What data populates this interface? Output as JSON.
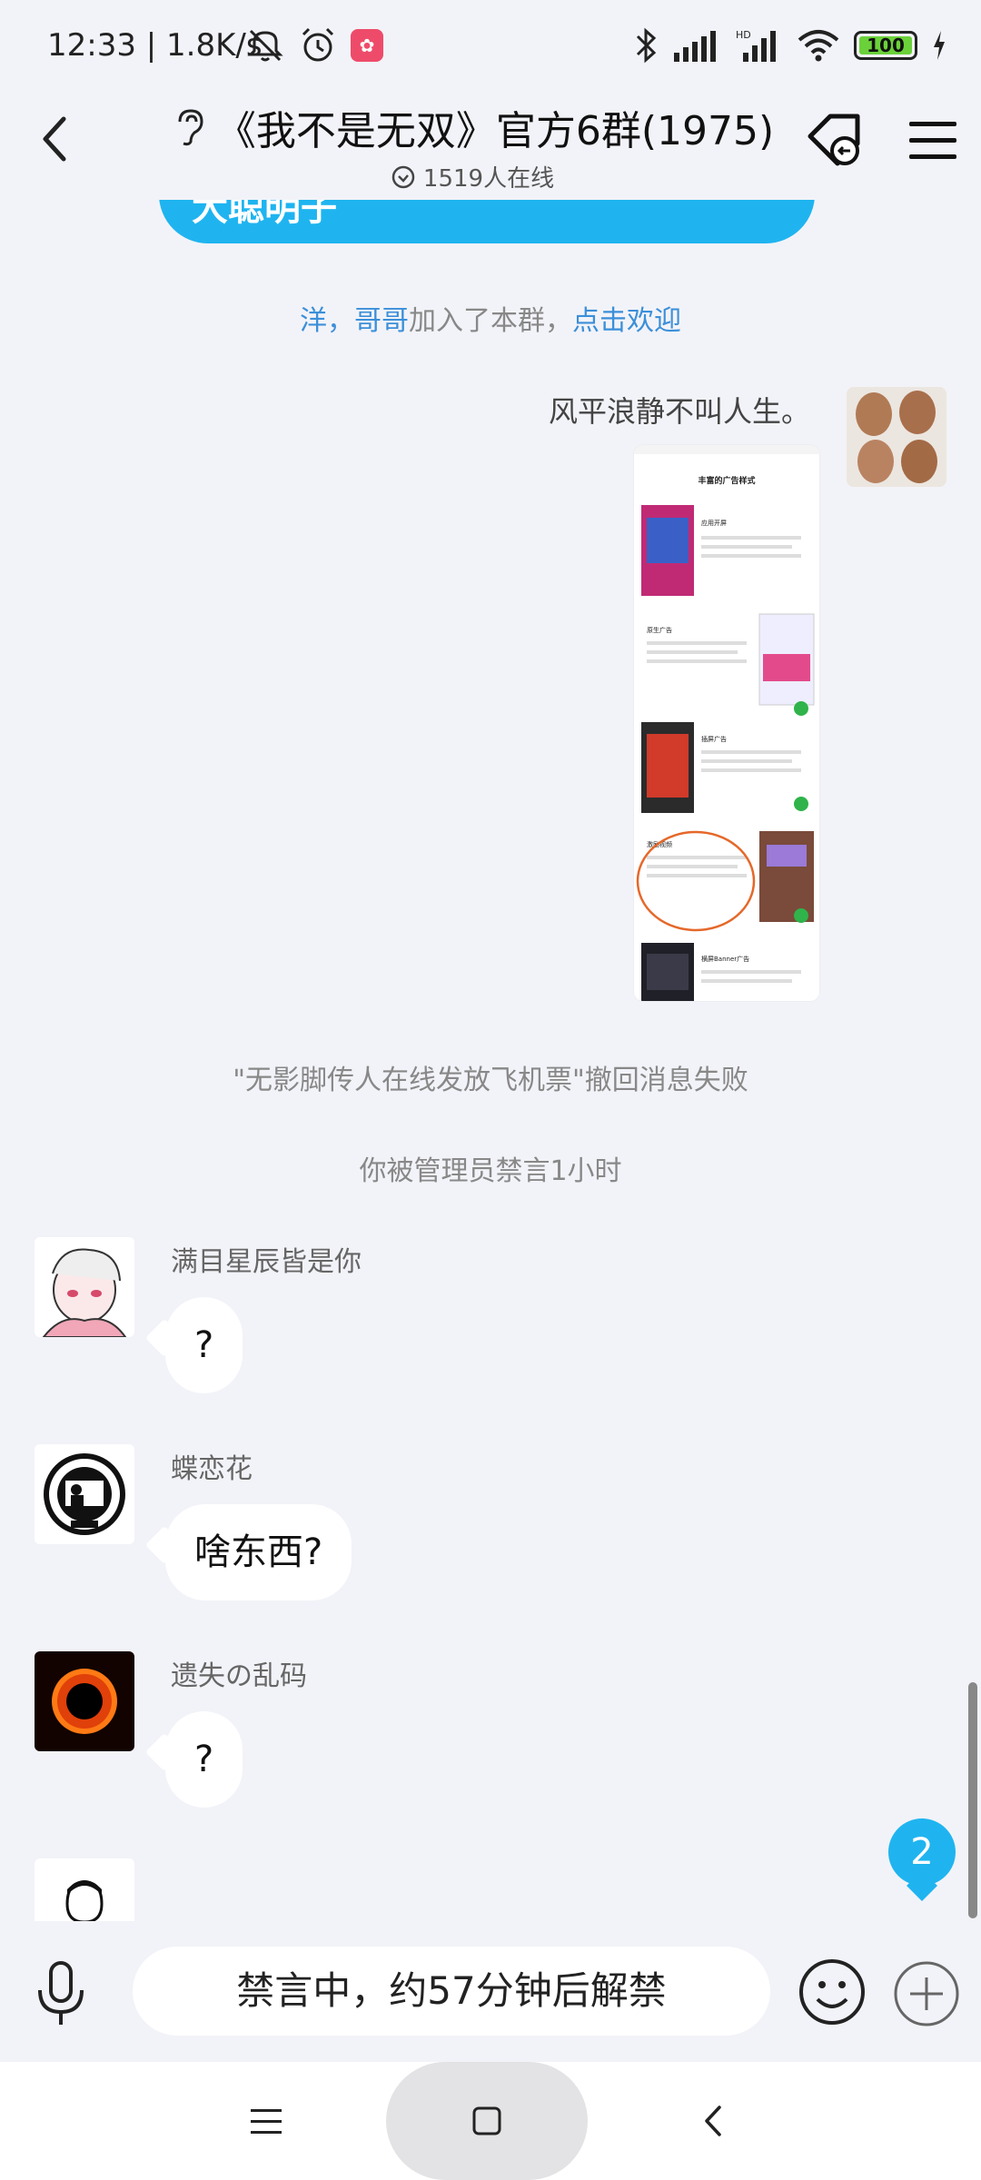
{
  "status_bar": {
    "time_speed": "12:33 | 1.8K/s",
    "battery": "100",
    "app_badge": "✿"
  },
  "header": {
    "title": "《我不是无双》官方6群(1975)",
    "online": "1519人在线"
  },
  "messages": {
    "prev_card_text": "大聪明子",
    "join_notice": {
      "name": "洋，哥哥",
      "text": "加入了本群，",
      "link": "点击欢迎"
    },
    "my_text": "风平浪静不叫人生。",
    "recall_failed": "\"无影脚传人在线发放飞机票\"撤回消息失败",
    "muted_notice": "你被管理员禁言1小时",
    "chat": [
      {
        "sender": "满目星辰皆是你",
        "text": "?"
      },
      {
        "sender": "蝶恋花",
        "text": "啥东西?"
      },
      {
        "sender": "遗失の乱码",
        "text": "?"
      }
    ]
  },
  "image_msg": {
    "title": "丰富的广告样式",
    "sections": [
      "应用开屏",
      "原生广告",
      "插屏广告",
      "激励视频",
      "横屏Banner广告"
    ]
  },
  "unread_count": "2",
  "input": {
    "text": "禁言中，约57分钟后解禁"
  },
  "icons": [
    "ear-icon",
    "back-icon",
    "clock-check-icon",
    "tag-return-icon",
    "menu-icon",
    "mic-icon",
    "emoji-icon",
    "plus-icon",
    "bluetooth-icon",
    "signal-icon",
    "wifi-icon",
    "alarm-icon",
    "mute-icon"
  ],
  "colors": {
    "accent": "#1fb4f0",
    "link": "#3b8fd9",
    "background": "#f2f3f8"
  }
}
